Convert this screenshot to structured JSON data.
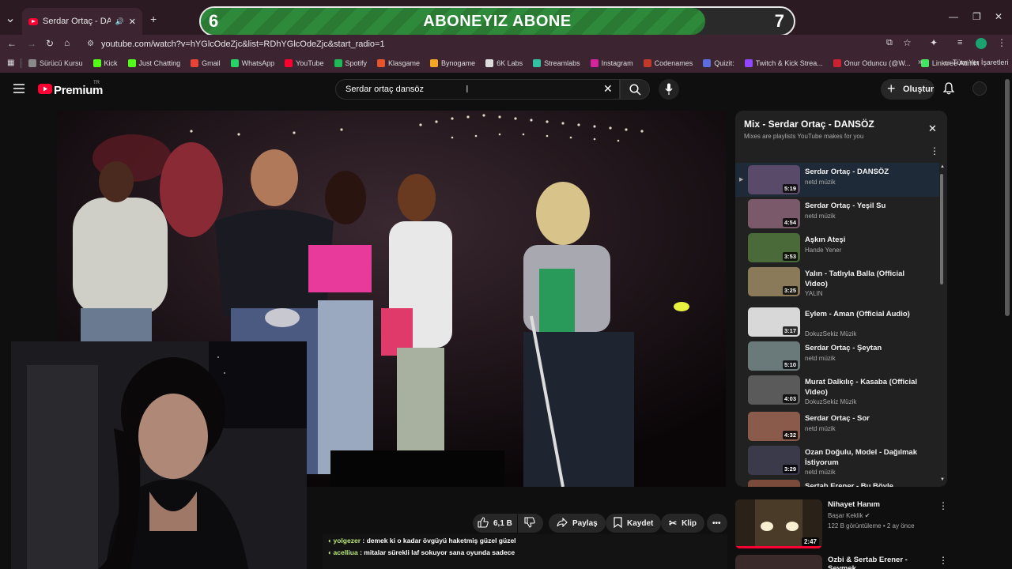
{
  "browser": {
    "tab_title": "Serdar Ortaç - DANSÖZ - YouTube",
    "url": "youtube.com/watch?v=hYGlcOdeZjc&list=RDhYGlcOdeZjc&start_radio=1",
    "bookmarks": [
      {
        "label": "Sürücü Kursu",
        "color": "#8a8a8a"
      },
      {
        "label": "Kick",
        "color": "#53fc18"
      },
      {
        "label": "Just Chatting",
        "color": "#53fc18"
      },
      {
        "label": "Gmail",
        "color": "#ea4335"
      },
      {
        "label": "WhatsApp",
        "color": "#25d366"
      },
      {
        "label": "YouTube",
        "color": "#ff0033"
      },
      {
        "label": "Spotify",
        "color": "#1db954"
      },
      {
        "label": "Klasgame",
        "color": "#e8542c"
      },
      {
        "label": "Bynogame",
        "color": "#f5a623"
      },
      {
        "label": "6K Labs",
        "color": "#dddddd"
      },
      {
        "label": "Streamlabs",
        "color": "#31c3a2"
      },
      {
        "label": "Instagram",
        "color": "#d6249f"
      },
      {
        "label": "Codenames",
        "color": "#c0392b"
      },
      {
        "label": "Quizit:",
        "color": "#5b6ee1"
      },
      {
        "label": "Twitch & Kick Strea...",
        "color": "#9146ff"
      },
      {
        "label": "Onur Oduncu (@W...",
        "color": "#cc2233"
      },
      {
        "label": "Linktree Admin",
        "color": "#43e660"
      }
    ],
    "all_bookmarks_label": "Tüm Yer İşaretleri"
  },
  "overlay": {
    "left_num": "6",
    "text": "ABONEYIZ ABONE",
    "right_num": "7",
    "progress": 0.85
  },
  "masthead": {
    "logo": "Premium",
    "logo_sup": "TR",
    "search_value": "Serdar ortaç dansöz",
    "create_label": "Oluştur"
  },
  "playlist": {
    "title": "Mix - Serdar Ortaç - DANSÖZ",
    "subtitle": "Mixes are playlists YouTube makes for you",
    "items": [
      {
        "title": "Serdar Ortaç - DANSÖZ",
        "channel": "netd müzik",
        "duration": "5:19",
        "color": "#5a4a6a",
        "current": true
      },
      {
        "title": "Serdar Ortaç - Yeşil Su",
        "channel": "netd müzik",
        "duration": "4:54",
        "color": "#7a5a6a"
      },
      {
        "title": "Aşkın Ateşi",
        "channel": "Hande Yener",
        "duration": "3:53",
        "color": "#4a6a3a"
      },
      {
        "title": "Yalın - Tatlıyla Balla (Official Video)",
        "channel": "YALIN",
        "duration": "3:25",
        "color": "#8a7a5a"
      },
      {
        "title": "Eylem - Aman (Official Audio)",
        "channel": "DokuzSekiz Müzik",
        "duration": "3:17",
        "color": "#d8d8d8"
      },
      {
        "title": "Serdar Ortaç - Şeytan",
        "channel": "netd müzik",
        "duration": "5:10",
        "color": "#6a7a7a"
      },
      {
        "title": "Murat Dalkılıç - Kasaba (Official Video)",
        "channel": "DokuzSekiz Müzik",
        "duration": "4:03",
        "color": "#5a5a5a"
      },
      {
        "title": "Serdar Ortaç - Sor",
        "channel": "netd müzik",
        "duration": "4:32",
        "color": "#8a5a4a"
      },
      {
        "title": "Ozan Doğulu, Model - Dağılmak İstiyorum",
        "channel": "netd müzik",
        "duration": "3:29",
        "color": "#3a3a4a"
      },
      {
        "title": "Sertab Erener - Bu Böyle",
        "channel": "",
        "duration": "",
        "color": "#7a4a3a"
      }
    ]
  },
  "actions": {
    "like_count": "6,1 B",
    "share": "Paylaş",
    "save": "Kaydet",
    "clip": "Klip"
  },
  "chat": [
    {
      "user": "yolgezer",
      "message": ": demek ki o kadar övgüyü haketmiş güzel güzel"
    },
    {
      "user": "acelliua",
      "message": ": mitalar sürekli laf sokuyor sana oyunda sadece"
    }
  ],
  "recommended": [
    {
      "title": "Nihayet Hanım",
      "channel": "Başar Keklik",
      "meta": "122 B görüntüleme • 2 ay önce",
      "duration": "2:47"
    },
    {
      "title": "Ozbi & Sertab Erener - Sevmek",
      "channel": "",
      "meta": "",
      "duration": ""
    }
  ]
}
